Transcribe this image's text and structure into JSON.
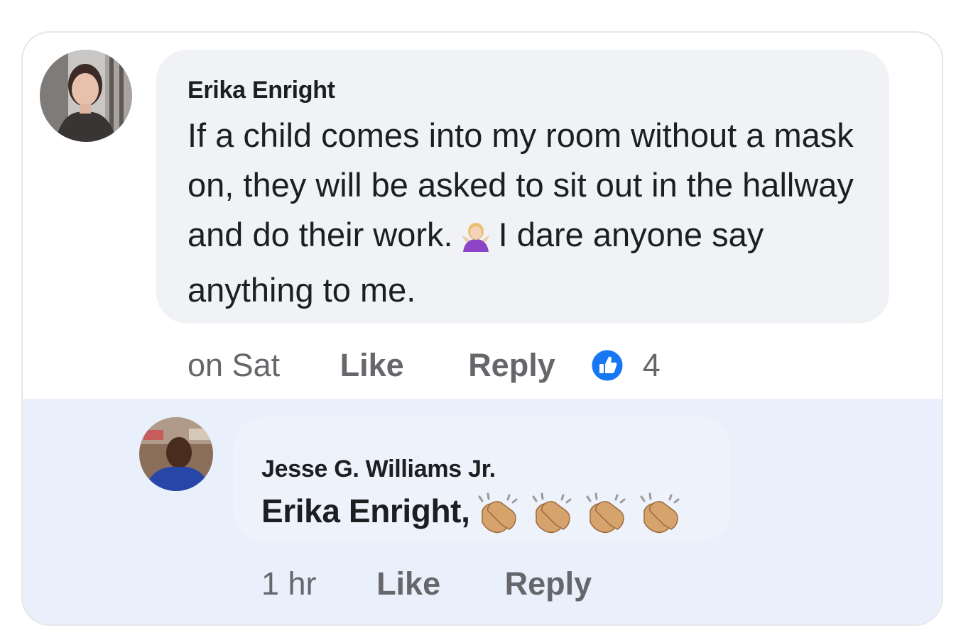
{
  "comment": {
    "author": "Erika Enright",
    "text_part1": "If a child comes into my room without a mask on, they will be asked to sit out in the hallway and do their work.",
    "emoji": "woman-shrugging-emoji",
    "text_part2": "I dare anyone say anything to me.",
    "time": "on Sat",
    "like_label": "Like",
    "reply_label": "Reply",
    "reaction_count": "4",
    "reaction_icon": "like-icon"
  },
  "reply": {
    "author": "Jesse G. Williams Jr.",
    "mention": "Erika Enright,",
    "emoji": "clapping-hands-emoji",
    "emoji_count": 4,
    "time": "1 hr",
    "like_label": "Like",
    "reply_label": "Reply"
  },
  "colors": {
    "text": "#1c1e21",
    "secondary_text": "#65676b",
    "bubble": "#f0f2f5",
    "highlight_background": "#e9f0fb",
    "like_blue": "#1877f2"
  }
}
